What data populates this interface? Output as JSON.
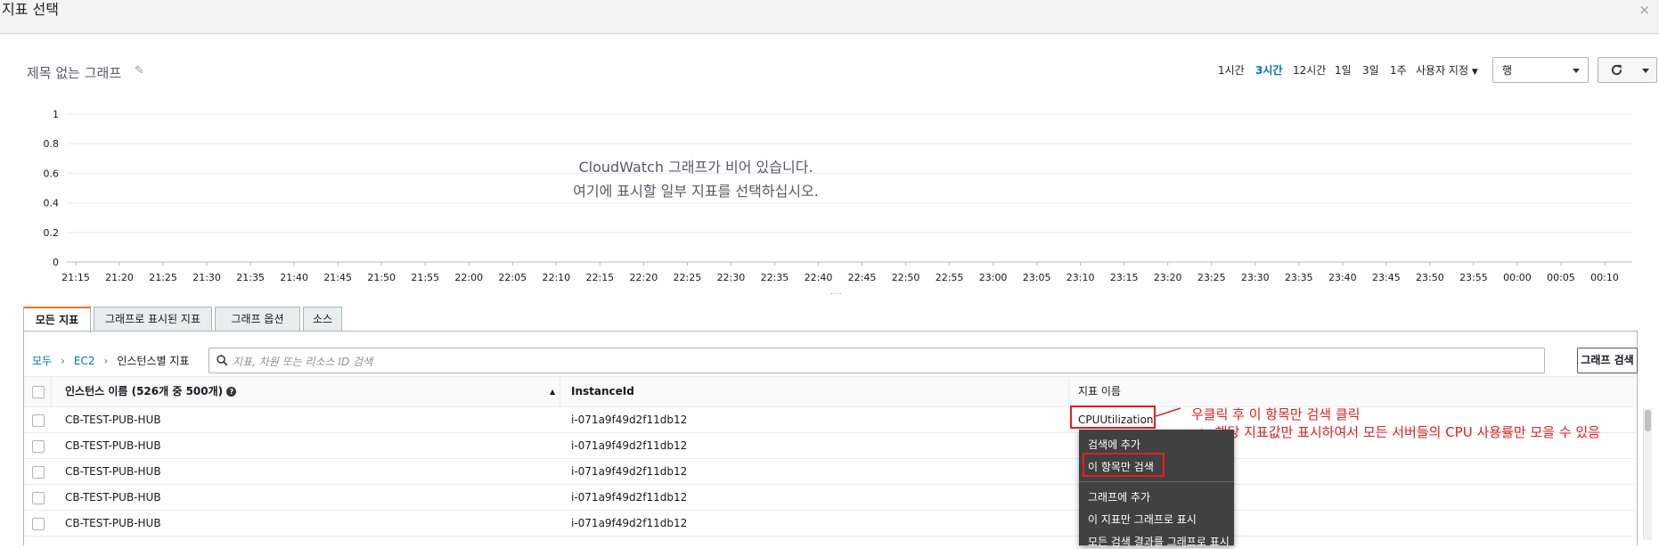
{
  "window": {
    "title": "지표 선택",
    "close_glyph": "×"
  },
  "graph": {
    "title": "제목 없는 그래프",
    "time_ranges": [
      "1시간",
      "3시간",
      "12시간",
      "1일",
      "3일",
      "1주"
    ],
    "active_range": "3시간",
    "custom_label": "사용자 지정",
    "view_select": "행",
    "empty_line1": "CloudWatch 그래프가 비어 있습니다.",
    "empty_line2": "여기에 표시할 일부 지표를 선택하십시오.",
    "resize_handle": "...."
  },
  "chart_data": {
    "type": "line",
    "series": [],
    "y_ticks": [
      "1",
      "0.8",
      "0.6",
      "0.4",
      "0.2",
      "0"
    ],
    "ylim": [
      0,
      1
    ],
    "x_ticks": [
      "21:15",
      "21:20",
      "21:25",
      "21:30",
      "21:35",
      "21:40",
      "21:45",
      "21:50",
      "21:55",
      "22:00",
      "22:05",
      "22:10",
      "22:15",
      "22:20",
      "22:25",
      "22:30",
      "22:35",
      "22:40",
      "22:45",
      "22:50",
      "22:55",
      "23:00",
      "23:05",
      "23:10",
      "23:15",
      "23:20",
      "23:25",
      "23:30",
      "23:35",
      "23:40",
      "23:45",
      "23:50",
      "23:55",
      "00:00",
      "00:05",
      "00:10"
    ],
    "grid": true
  },
  "tabs": [
    "모든 지표",
    "그래프로 표시된 지표",
    "그래프 옵션",
    "소스"
  ],
  "browse": {
    "crumbs": [
      "모두",
      "EC2",
      "인스턴스별 지표"
    ],
    "search_placeholder": "지표, 차원 또는 리소스 ID 검색",
    "graph_search_label": "그래프 검색"
  },
  "table": {
    "headers": [
      "인스턴스 이름 (526개 중 500개)",
      "InstanceId",
      "지표 이름"
    ],
    "help_glyph": "?",
    "rows": [
      {
        "name": "CB-TEST-PUB-HUB",
        "id": "i-071a9f49d2f11db12",
        "metric": "CPUUtilization"
      },
      {
        "name": "CB-TEST-PUB-HUB",
        "id": "i-071a9f49d2f11db12",
        "metric": ""
      },
      {
        "name": "CB-TEST-PUB-HUB",
        "id": "i-071a9f49d2f11db12",
        "metric": ""
      },
      {
        "name": "CB-TEST-PUB-HUB",
        "id": "i-071a9f49d2f11db12",
        "metric": ""
      },
      {
        "name": "CB-TEST-PUB-HUB",
        "id": "i-071a9f49d2f11db12",
        "metric": ""
      }
    ]
  },
  "context_menu": {
    "items": [
      "검색에 추가",
      "이 항목만 검색",
      "그래프에 추가",
      "이 지표만 그래프로 표시",
      "모든 검색 결과를 그래프로 표시"
    ]
  },
  "annotation": {
    "line1": "우클릭 후 이 항목만 검색 클릭",
    "line2": "-> 해당 지표값만 표시하여서 모든 서버들의 CPU 사용률만 모을 수 있음"
  },
  "colors": {
    "accent": "#0073bb",
    "tab_accent": "#ec7211",
    "annotation": "#e02020",
    "menu_bg": "#414141"
  }
}
